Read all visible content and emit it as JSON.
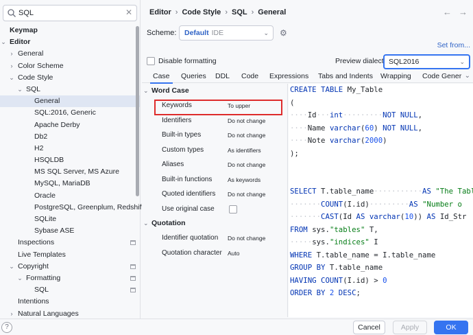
{
  "search": {
    "value": "SQL"
  },
  "tree": [
    {
      "label": "Keymap",
      "depth": 0,
      "bold": true,
      "arrow": ""
    },
    {
      "label": "Editor",
      "depth": 0,
      "bold": true,
      "arrow": "down"
    },
    {
      "label": "General",
      "depth": 1,
      "arrow": "right"
    },
    {
      "label": "Color Scheme",
      "depth": 1,
      "arrow": "right"
    },
    {
      "label": "Code Style",
      "depth": 1,
      "arrow": "down"
    },
    {
      "label": "SQL",
      "depth": 2,
      "arrow": "down"
    },
    {
      "label": "General",
      "depth": 3,
      "selected": true
    },
    {
      "label": "SQL:2016, Generic",
      "depth": 3
    },
    {
      "label": "Apache Derby",
      "depth": 3
    },
    {
      "label": "Db2",
      "depth": 3
    },
    {
      "label": "H2",
      "depth": 3
    },
    {
      "label": "HSQLDB",
      "depth": 3
    },
    {
      "label": "MS SQL Server, MS Azure",
      "depth": 3
    },
    {
      "label": "MySQL, MariaDB",
      "depth": 3
    },
    {
      "label": "Oracle",
      "depth": 3
    },
    {
      "label": "PostgreSQL, Greenplum, Redshift",
      "depth": 3
    },
    {
      "label": "SQLite",
      "depth": 3
    },
    {
      "label": "Sybase ASE",
      "depth": 3
    },
    {
      "label": "Inspections",
      "depth": 1,
      "mini": true
    },
    {
      "label": "Live Templates",
      "depth": 1
    },
    {
      "label": "Copyright",
      "depth": 1,
      "arrow": "down",
      "mini": true
    },
    {
      "label": "Formatting",
      "depth": 2,
      "arrow": "down",
      "mini": true
    },
    {
      "label": "SQL",
      "depth": 3,
      "mini": true
    },
    {
      "label": "Intentions",
      "depth": 1
    },
    {
      "label": "Natural Languages",
      "depth": 1,
      "arrow": "right"
    }
  ],
  "breadcrumb": [
    "Editor",
    "Code Style",
    "SQL",
    "General"
  ],
  "scheme": {
    "label": "Scheme:",
    "name": "Default",
    "tag": "IDE"
  },
  "set_from": "Set from...",
  "disable_formatting": {
    "label": "Disable formatting",
    "checked": false
  },
  "preview_dialect": {
    "label": "Preview dialect:",
    "value": "SQL2016"
  },
  "tabs": [
    "Case",
    "Queries",
    "DDL",
    "Code",
    "Expressions",
    "Tabs and Indents",
    "Wrapping",
    "Code Gener"
  ],
  "options": {
    "word_case": {
      "title": "Word Case",
      "rows": [
        {
          "key": "Keywords",
          "value": "To upper"
        },
        {
          "key": "Identifiers",
          "value": "Do not change"
        },
        {
          "key": "Built-in types",
          "value": "Do not change"
        },
        {
          "key": "Custom types",
          "value": "As identifiers"
        },
        {
          "key": "Aliases",
          "value": "Do not change"
        },
        {
          "key": "Built-in functions",
          "value": "As keywords"
        },
        {
          "key": "Quoted identifiers",
          "value": "Do not change"
        },
        {
          "key": "Use original case",
          "value": ""
        }
      ]
    },
    "quotation": {
      "title": "Quotation",
      "rows": [
        {
          "key": "Identifier quotation",
          "value": "Do not change"
        },
        {
          "key": "Quotation character",
          "value": "Auto"
        }
      ]
    }
  },
  "code_lines": [
    [
      [
        "kw",
        "CREATE TABLE "
      ],
      [
        "",
        "My_Table"
      ]
    ],
    [
      [
        "",
        "("
      ]
    ],
    [
      [
        "ws",
        "····"
      ],
      [
        "",
        "Id"
      ],
      [
        "ws",
        "···"
      ],
      [
        "kw",
        "int"
      ],
      [
        "ws",
        "·········"
      ],
      [
        "kw",
        "NOT NULL"
      ],
      [
        "",
        ","
      ]
    ],
    [
      [
        "ws",
        "····"
      ],
      [
        "",
        "Name "
      ],
      [
        "kw",
        "varchar"
      ],
      [
        "",
        "("
      ],
      [
        "num",
        "60"
      ],
      [
        "",
        ") "
      ],
      [
        "kw",
        "NOT NULL"
      ],
      [
        "",
        ","
      ]
    ],
    [
      [
        "ws",
        "····"
      ],
      [
        "",
        "Note "
      ],
      [
        "kw",
        "varchar"
      ],
      [
        "",
        "("
      ],
      [
        "num",
        "2000"
      ],
      [
        "",
        ")"
      ]
    ],
    [
      [
        "",
        ");"
      ]
    ],
    [],
    [],
    [
      [
        "kw",
        "SELECT "
      ],
      [
        "",
        "T.table_name"
      ],
      [
        "ws",
        "···········"
      ],
      [
        "kw",
        "AS "
      ],
      [
        "str",
        "\"The Table"
      ]
    ],
    [
      [
        "ws",
        "·······"
      ],
      [
        "kw",
        "COUNT"
      ],
      [
        "",
        "(I.id)"
      ],
      [
        "ws",
        "·········"
      ],
      [
        "kw",
        "AS "
      ],
      [
        "str",
        "\"Number o"
      ]
    ],
    [
      [
        "ws",
        "·······"
      ],
      [
        "kw",
        "CAST"
      ],
      [
        "",
        "(Id "
      ],
      [
        "kw",
        "AS varchar"
      ],
      [
        "",
        "("
      ],
      [
        "num",
        "10"
      ],
      [
        "",
        ")) "
      ],
      [
        "kw",
        "AS "
      ],
      [
        "",
        "Id_Str"
      ]
    ],
    [
      [
        "kw",
        "FROM "
      ],
      [
        "",
        "sys."
      ],
      [
        "str",
        "\"tables\""
      ],
      [
        "",
        " T,"
      ]
    ],
    [
      [
        "ws",
        "·····"
      ],
      [
        "",
        "sys."
      ],
      [
        "str",
        "\"indices\""
      ],
      [
        "",
        " I"
      ]
    ],
    [
      [
        "kw",
        "WHERE "
      ],
      [
        "",
        "T.table_name = I.table_name"
      ]
    ],
    [
      [
        "kw",
        "GROUP BY "
      ],
      [
        "",
        "T.table_name"
      ]
    ],
    [
      [
        "kw",
        "HAVING COUNT"
      ],
      [
        "",
        "(I.id) > "
      ],
      [
        "num",
        "0"
      ]
    ],
    [
      [
        "kw",
        "ORDER BY "
      ],
      [
        "num",
        "2 "
      ],
      [
        "kw",
        "DESC"
      ],
      [
        "",
        ";"
      ]
    ]
  ],
  "buttons": {
    "help": "?",
    "cancel": "Cancel",
    "apply": "Apply",
    "ok": "OK"
  },
  "colors": {
    "accent": "#3574f0",
    "highlight": "#de2b2b",
    "keyword": "#0033b3",
    "number": "#1750eb",
    "string": "#067d17"
  }
}
